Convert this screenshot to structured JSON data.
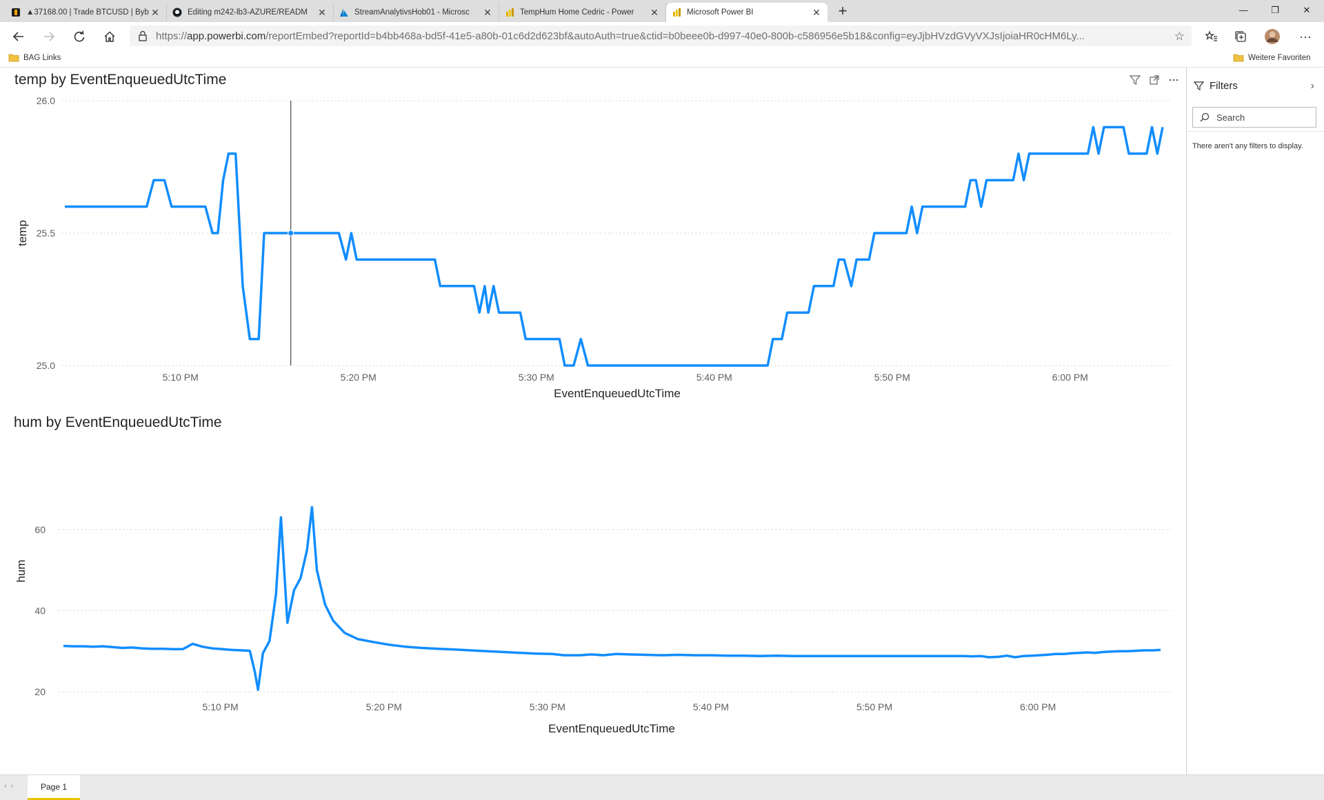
{
  "browser": {
    "tabs": [
      {
        "title": "▲37168.00 | Trade BTCUSD | Byb",
        "icon": "bybit-icon"
      },
      {
        "title": "Editing m242-lb3-AZURE/READM",
        "icon": "github-icon"
      },
      {
        "title": "StreamAnalytivsHob01 - Microsc",
        "icon": "azure-icon"
      },
      {
        "title": "TempHum Home Cedric - Power",
        "icon": "powerbi-icon"
      },
      {
        "title": "Microsoft Power BI",
        "icon": "powerbi-icon",
        "active": true
      }
    ],
    "url_prefix": "https://",
    "url_host": "app.powerbi.com",
    "url_rest": "/reportEmbed?reportId=b4bb468a-bd5f-41e5-a80b-01c6d2d623bf&autoAuth=true&ctid=b0beee0b-d997-40e0-800b-c586956e5b18&config=eyJjbHVzdGVyVXJsIjoiaHR0cHM6Ly...",
    "favorites": {
      "left": "BAG Links",
      "right": "Weitere Favoriten"
    }
  },
  "report": {
    "accent": "#118DFF",
    "chart_data": [
      {
        "type": "line",
        "title": "temp by EventEnqueuedUtcTime",
        "xlabel": "EventEnqueuedUtcTime",
        "ylabel": "temp",
        "ytick_labels": [
          "25.0",
          "25.5",
          "26.0"
        ],
        "yticks": [
          25.0,
          25.5,
          26.0
        ],
        "ylim": [
          25.0,
          26.0
        ],
        "xtick_labels": [
          "5:10 PM",
          "5:20 PM",
          "5:30 PM",
          "5:40 PM",
          "5:50 PM",
          "6:00 PM"
        ],
        "xticks": [
          10,
          20,
          30,
          40,
          50,
          60
        ],
        "xlim": [
          0.4,
          61.1
        ],
        "grid": true,
        "hover_x": 16.2,
        "series": [
          {
            "values": [
              [
                3.5,
                25.6
              ],
              [
                8.1,
                25.6
              ],
              [
                8.5,
                25.7
              ],
              [
                9.1,
                25.7
              ],
              [
                9.5,
                25.6
              ],
              [
                11.4,
                25.6
              ],
              [
                11.8,
                25.5
              ],
              [
                12.1,
                25.5
              ],
              [
                12.4,
                25.7
              ],
              [
                12.7,
                25.8
              ],
              [
                13.1,
                25.8
              ],
              [
                13.5,
                25.3
              ],
              [
                13.9,
                25.1
              ],
              [
                14.4,
                25.1
              ],
              [
                14.7,
                25.5
              ],
              [
                18.9,
                25.5
              ],
              [
                19.3,
                25.4
              ],
              [
                19.6,
                25.5
              ],
              [
                19.9,
                25.4
              ],
              [
                21.3,
                25.4
              ],
              [
                22.0,
                25.4
              ],
              [
                24.3,
                25.4
              ],
              [
                24.6,
                25.3
              ],
              [
                26.5,
                25.3
              ],
              [
                26.8,
                25.2
              ],
              [
                27.1,
                25.3
              ],
              [
                27.3,
                25.2
              ],
              [
                27.6,
                25.3
              ],
              [
                27.9,
                25.2
              ],
              [
                29.1,
                25.2
              ],
              [
                29.4,
                25.1
              ],
              [
                31.3,
                25.1
              ],
              [
                31.6,
                25.0
              ],
              [
                32.1,
                25.0
              ],
              [
                32.5,
                25.1
              ],
              [
                32.9,
                25.0
              ],
              [
                34.8,
                25.0
              ],
              [
                43.0,
                25.0
              ],
              [
                43.3,
                25.1
              ],
              [
                43.8,
                25.1
              ],
              [
                44.1,
                25.2
              ],
              [
                45.3,
                25.2
              ],
              [
                45.6,
                25.3
              ],
              [
                46.7,
                25.3
              ],
              [
                47.0,
                25.4
              ],
              [
                47.3,
                25.4
              ],
              [
                47.7,
                25.3
              ],
              [
                48.0,
                25.4
              ],
              [
                48.7,
                25.4
              ],
              [
                49.0,
                25.5
              ],
              [
                50.8,
                25.5
              ],
              [
                51.1,
                25.6
              ],
              [
                51.4,
                25.5
              ],
              [
                51.7,
                25.6
              ],
              [
                54.1,
                25.6
              ],
              [
                54.4,
                25.7
              ],
              [
                54.7,
                25.7
              ],
              [
                55.0,
                25.6
              ],
              [
                55.3,
                25.7
              ],
              [
                56.8,
                25.7
              ],
              [
                57.1,
                25.8
              ],
              [
                57.4,
                25.7
              ],
              [
                57.7,
                25.8
              ],
              [
                61.0,
                25.8
              ],
              [
                61.3,
                25.9
              ],
              [
                61.6,
                25.8
              ],
              [
                61.9,
                25.9
              ],
              [
                63.0,
                25.9
              ],
              [
                63.3,
                25.8
              ],
              [
                64.3,
                25.8
              ],
              [
                64.6,
                25.9
              ],
              [
                64.9,
                25.8
              ],
              [
                65.2,
                25.9
              ]
            ]
          }
        ]
      },
      {
        "type": "line",
        "title": "hum by EventEnqueuedUtcTime",
        "xlabel": "EventEnqueuedUtcTime",
        "ylabel": "hum",
        "ytick_labels": [
          "20",
          "40",
          "60"
        ],
        "yticks": [
          20,
          40,
          60
        ],
        "ylim": [
          20,
          70
        ],
        "xtick_labels": [
          "5:10 PM",
          "5:20 PM",
          "5:30 PM",
          "5:40 PM",
          "5:50 PM",
          "6:00 PM"
        ],
        "xticks": [
          10,
          20,
          30,
          40,
          50,
          60
        ],
        "xlim": [
          0.4,
          61.1
        ],
        "grid": true,
        "series": [
          {
            "values": [
              [
                0.4,
                31.3
              ],
              [
                1.0,
                31.2
              ],
              [
                1.6,
                31.2
              ],
              [
                2.2,
                31.1
              ],
              [
                2.8,
                31.2
              ],
              [
                3.4,
                31.0
              ],
              [
                4.0,
                30.8
              ],
              [
                4.6,
                30.9
              ],
              [
                5.2,
                30.7
              ],
              [
                5.8,
                30.6
              ],
              [
                6.5,
                30.6
              ],
              [
                7.1,
                30.5
              ],
              [
                7.7,
                30.5
              ],
              [
                8.3,
                31.8
              ],
              [
                8.9,
                31.1
              ],
              [
                9.5,
                30.7
              ],
              [
                10.1,
                30.5
              ],
              [
                10.7,
                30.3
              ],
              [
                11.3,
                30.2
              ],
              [
                11.8,
                30.1
              ],
              [
                12.1,
                25.0
              ],
              [
                12.3,
                20.5
              ],
              [
                12.6,
                29.5
              ],
              [
                13.0,
                32.5
              ],
              [
                13.4,
                44.0
              ],
              [
                13.7,
                63.0
              ],
              [
                14.1,
                37.0
              ],
              [
                14.5,
                45.0
              ],
              [
                14.9,
                48.0
              ],
              [
                15.3,
                55.0
              ],
              [
                15.6,
                65.5
              ],
              [
                15.9,
                50.0
              ],
              [
                16.4,
                41.5
              ],
              [
                16.9,
                37.5
              ],
              [
                17.6,
                34.5
              ],
              [
                18.4,
                33.0
              ],
              [
                19.3,
                32.3
              ],
              [
                20.3,
                31.6
              ],
              [
                21.3,
                31.1
              ],
              [
                22.3,
                30.8
              ],
              [
                23.3,
                30.6
              ],
              [
                24.3,
                30.4
              ],
              [
                25.3,
                30.2
              ],
              [
                26.3,
                30.0
              ],
              [
                27.3,
                29.8
              ],
              [
                28.3,
                29.6
              ],
              [
                29.3,
                29.4
              ],
              [
                30.3,
                29.3
              ],
              [
                31.0,
                29.0
              ],
              [
                32.0,
                29.0
              ],
              [
                32.7,
                29.2
              ],
              [
                33.4,
                29.0
              ],
              [
                34.2,
                29.3
              ],
              [
                35.0,
                29.2
              ],
              [
                36.0,
                29.1
              ],
              [
                37.0,
                29.0
              ],
              [
                38.0,
                29.1
              ],
              [
                39.0,
                29.0
              ],
              [
                40.0,
                29.0
              ],
              [
                41.0,
                28.9
              ],
              [
                42.0,
                28.9
              ],
              [
                43.0,
                28.8
              ],
              [
                44.0,
                28.9
              ],
              [
                45.0,
                28.8
              ],
              [
                46.0,
                28.8
              ],
              [
                47.0,
                28.8
              ],
              [
                48.0,
                28.8
              ],
              [
                49.0,
                28.8
              ],
              [
                50.0,
                28.8
              ],
              [
                51.0,
                28.8
              ],
              [
                52.0,
                28.8
              ],
              [
                53.0,
                28.8
              ],
              [
                53.7,
                28.8
              ],
              [
                54.2,
                28.8
              ],
              [
                55.0,
                28.8
              ],
              [
                55.5,
                28.8
              ],
              [
                56.0,
                28.7
              ],
              [
                56.5,
                28.8
              ],
              [
                57.0,
                28.5
              ],
              [
                57.6,
                28.6
              ],
              [
                58.1,
                28.9
              ],
              [
                58.6,
                28.5
              ],
              [
                59.1,
                28.8
              ],
              [
                59.6,
                28.9
              ],
              [
                60.1,
                29.0
              ],
              [
                60.5,
                29.1
              ],
              [
                61.1,
                29.3
              ],
              [
                61.6,
                29.3
              ],
              [
                62.1,
                29.5
              ],
              [
                62.6,
                29.6
              ],
              [
                63.0,
                29.7
              ],
              [
                63.5,
                29.6
              ],
              [
                64.0,
                29.8
              ],
              [
                64.5,
                29.9
              ],
              [
                65.0,
                30.0
              ],
              [
                65.5,
                30.0
              ],
              [
                66.0,
                30.1
              ],
              [
                66.5,
                30.2
              ],
              [
                67.0,
                30.2
              ],
              [
                67.5,
                30.3
              ]
            ]
          }
        ]
      }
    ]
  },
  "filters": {
    "title": "Filters",
    "search_placeholder": "Search",
    "empty_text": "There aren't any filters to display."
  },
  "pages": [
    {
      "label": "Page 1",
      "active": true
    }
  ]
}
